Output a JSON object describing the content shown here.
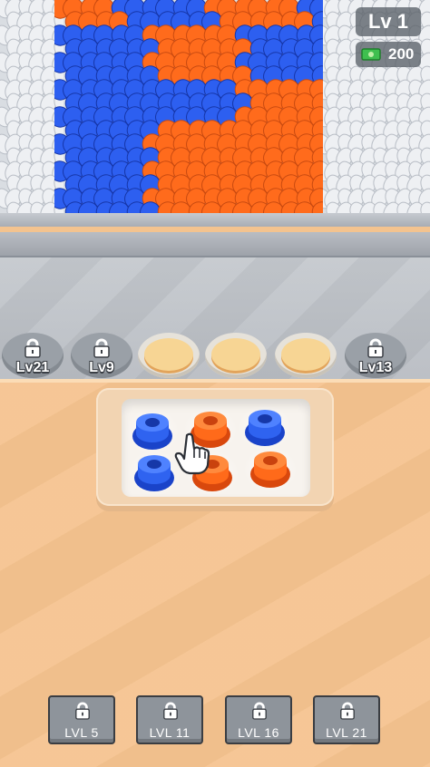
{
  "hud": {
    "level": "Lv 1",
    "money": "200",
    "money_icon": "cash-icon"
  },
  "colors": {
    "blue": "#2f63f0",
    "orange": "#ff6a1a",
    "white_yarn": "#f1f2f4",
    "table": "#f5c38f"
  },
  "slots": [
    {
      "state": "locked",
      "label": "Lv21"
    },
    {
      "state": "locked",
      "label": "Lv9"
    },
    {
      "state": "open",
      "label": ""
    },
    {
      "state": "open",
      "label": ""
    },
    {
      "state": "open",
      "label": ""
    },
    {
      "state": "locked",
      "label": "Lv13"
    }
  ],
  "spools": [
    {
      "color": "blue"
    },
    {
      "color": "orange"
    },
    {
      "color": "blue"
    },
    {
      "color": "blue"
    },
    {
      "color": "orange"
    },
    {
      "color": "orange"
    }
  ],
  "level_buttons": [
    {
      "label": "LVL 5"
    },
    {
      "label": "LVL 11"
    },
    {
      "label": "LVL 16"
    },
    {
      "label": "LVL 21"
    }
  ]
}
